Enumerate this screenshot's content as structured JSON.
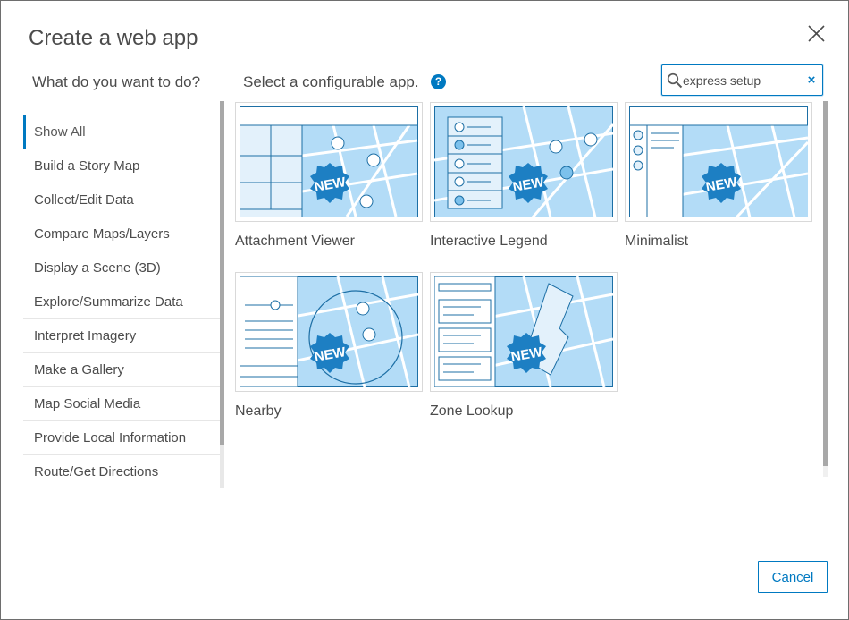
{
  "dialog": {
    "title": "Create a web app",
    "question": "What do you want to do?",
    "select_label": "Select a configurable app.",
    "help_icon": "?",
    "search": {
      "value": "express setup",
      "clear": "×"
    },
    "cancel_label": "Cancel"
  },
  "sidebar": {
    "items": [
      {
        "label": "Show All"
      },
      {
        "label": "Build a Story Map"
      },
      {
        "label": "Collect/Edit Data"
      },
      {
        "label": "Compare Maps/Layers"
      },
      {
        "label": "Display a Scene (3D)"
      },
      {
        "label": "Explore/Summarize Data"
      },
      {
        "label": "Interpret Imagery"
      },
      {
        "label": "Make a Gallery"
      },
      {
        "label": "Map Social Media"
      },
      {
        "label": "Provide Local Information"
      },
      {
        "label": "Route/Get Directions"
      }
    ]
  },
  "apps": [
    {
      "label": "Attachment Viewer",
      "badge": "NEW",
      "icon": "attachment-viewer-thumbnail"
    },
    {
      "label": "Interactive Legend",
      "badge": "NEW",
      "icon": "interactive-legend-thumbnail"
    },
    {
      "label": "Minimalist",
      "badge": "NEW",
      "icon": "minimalist-thumbnail"
    },
    {
      "label": "Nearby",
      "badge": "NEW",
      "icon": "nearby-thumbnail"
    },
    {
      "label": "Zone Lookup",
      "badge": "NEW",
      "icon": "zone-lookup-thumbnail"
    }
  ],
  "colors": {
    "accent": "#0079c1",
    "map_fill": "#b3dcf7",
    "badge": "#1d7fc3"
  }
}
